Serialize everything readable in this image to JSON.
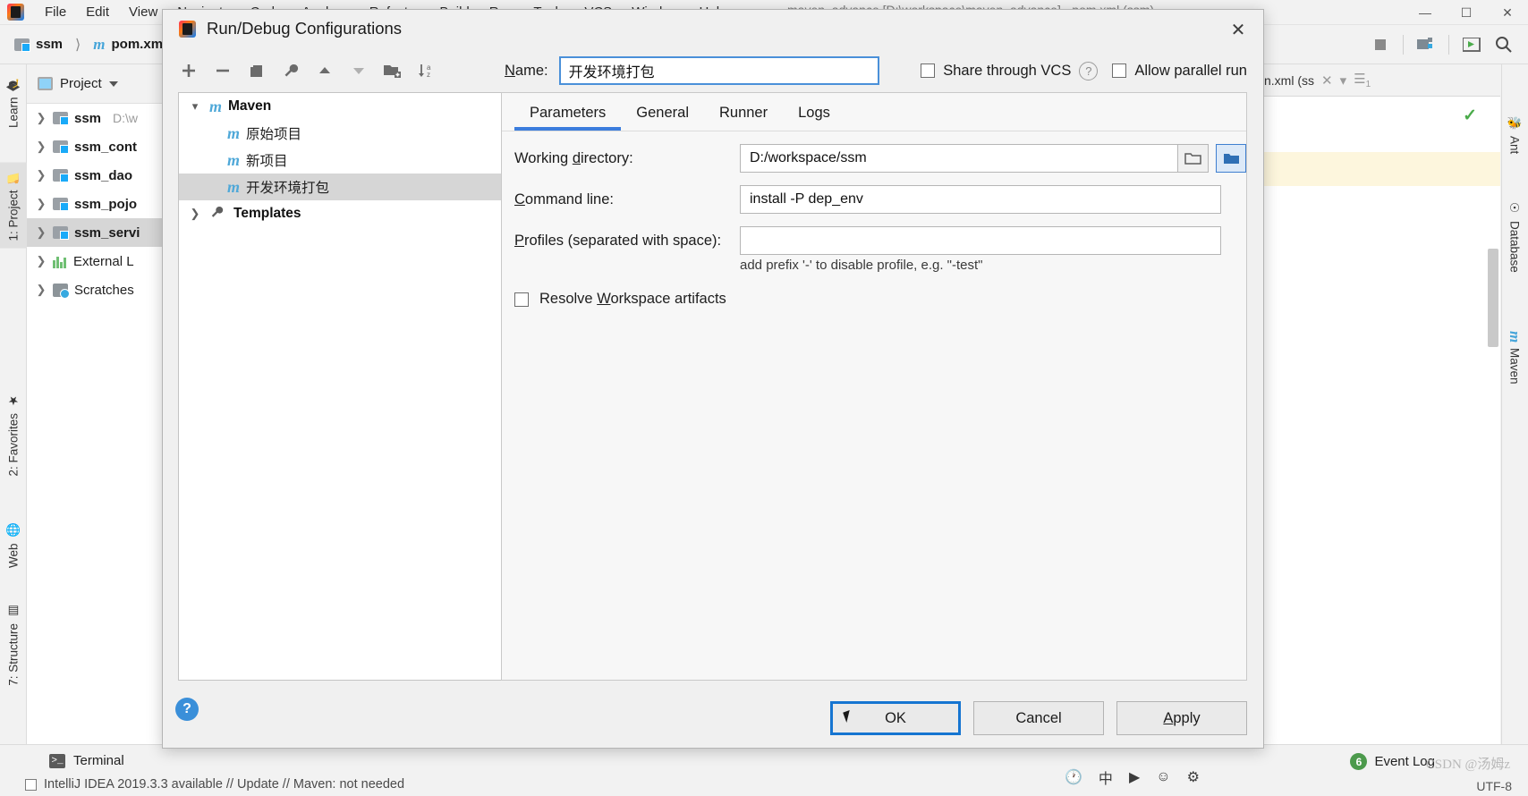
{
  "ide": {
    "window_title": "maven_advance [D:\\workspace\\maven_advance] - pom.xml (ssm)",
    "menu": [
      "File",
      "Edit",
      "View",
      "Navigate",
      "Code",
      "Analyze",
      "Refactor",
      "Build",
      "Run",
      "Tools",
      "VCS",
      "Window",
      "Help"
    ],
    "breadcrumb": {
      "project": "ssm",
      "file": "pom.xml"
    },
    "project_panel": {
      "title": "Project",
      "rows": [
        {
          "name": "ssm",
          "path": "D:\\w",
          "icon": "folder-module-icon",
          "selected": false
        },
        {
          "name": "ssm_cont",
          "path": "",
          "icon": "folder-module-icon",
          "selected": false
        },
        {
          "name": "ssm_dao",
          "path": "",
          "icon": "folder-module-icon",
          "selected": false
        },
        {
          "name": "ssm_pojo",
          "path": "",
          "icon": "folder-module-icon",
          "selected": false
        },
        {
          "name": "ssm_servi",
          "path": "",
          "icon": "folder-module-icon",
          "selected": true
        },
        {
          "name": "External L",
          "path": "",
          "icon": "library-icon",
          "selected": false
        },
        {
          "name": "Scratches",
          "path": "",
          "icon": "scratches-icon",
          "selected": false
        }
      ]
    },
    "left_tabs": [
      "Learn",
      "1: Project",
      "2: Favorites",
      "Web",
      "7: Structure"
    ],
    "right_tabs": [
      "Ant",
      "Database",
      "Maven"
    ],
    "editor_tab": "n.xml (ss",
    "status": {
      "terminal": "Terminal",
      "event_log": "Event Log",
      "event_log_count": "6",
      "hint": "IntelliJ IDEA 2019.3.3 available // Update // Maven: not needed",
      "encoding": "UTF-8",
      "watermark": "CSDN @汤姆z"
    }
  },
  "dialog": {
    "title": "Run/Debug Configurations",
    "close_label": "✕",
    "toolbar": [
      {
        "name": "add",
        "glyph": "+"
      },
      {
        "name": "remove",
        "glyph": "−"
      },
      {
        "name": "copy",
        "glyph": "⧉"
      },
      {
        "name": "edit-templates",
        "glyph": "wrench"
      },
      {
        "name": "move-up",
        "glyph": "▲"
      },
      {
        "name": "move-down",
        "glyph": "▼"
      },
      {
        "name": "new-folder",
        "glyph": "folder-plus"
      },
      {
        "name": "sort-alphabetically",
        "glyph": "↓az"
      }
    ],
    "tree": [
      {
        "label": "Maven",
        "icon": "maven-icon",
        "depth": 0,
        "expanded": true,
        "bold": true,
        "selected": false
      },
      {
        "label": "原始项目",
        "icon": "maven-icon",
        "depth": 1,
        "bold": false,
        "selected": false
      },
      {
        "label": "新项目",
        "icon": "maven-icon",
        "depth": 1,
        "bold": false,
        "selected": false
      },
      {
        "label": "开发环境打包",
        "icon": "maven-icon",
        "depth": 1,
        "bold": false,
        "selected": true
      },
      {
        "label": "Templates",
        "icon": "wrench-icon",
        "depth": 0,
        "expanded": false,
        "bold": true,
        "selected": false
      }
    ],
    "name_label": "Name:",
    "name_value": "开发环境打包",
    "share_vcs_label": "Share through VCS",
    "share_vcs_checked": false,
    "allow_parallel_label": "Allow parallel run",
    "allow_parallel_checked": false,
    "help_icon": "?",
    "tabs": [
      {
        "label": "Parameters",
        "active": true
      },
      {
        "label": "General",
        "active": false
      },
      {
        "label": "Runner",
        "active": false
      },
      {
        "label": "Logs",
        "active": false
      }
    ],
    "fields": {
      "working_directory_label": "Working directory:",
      "working_directory_value": "D:/workspace/ssm",
      "command_line_label": "Command line:",
      "command_line_value": "install -P dep_env",
      "profiles_label": "Profiles (separated with space):",
      "profiles_value": "",
      "profiles_hint": "add prefix '-' to disable profile, e.g. \"-test\"",
      "resolve_workspace_label": "Resolve Workspace artifacts",
      "resolve_workspace_checked": false
    },
    "buttons": {
      "ok": "OK",
      "cancel": "Cancel",
      "apply": "Apply"
    },
    "accent_color": "#3b7ddd",
    "focus_color": "#1675d1"
  }
}
